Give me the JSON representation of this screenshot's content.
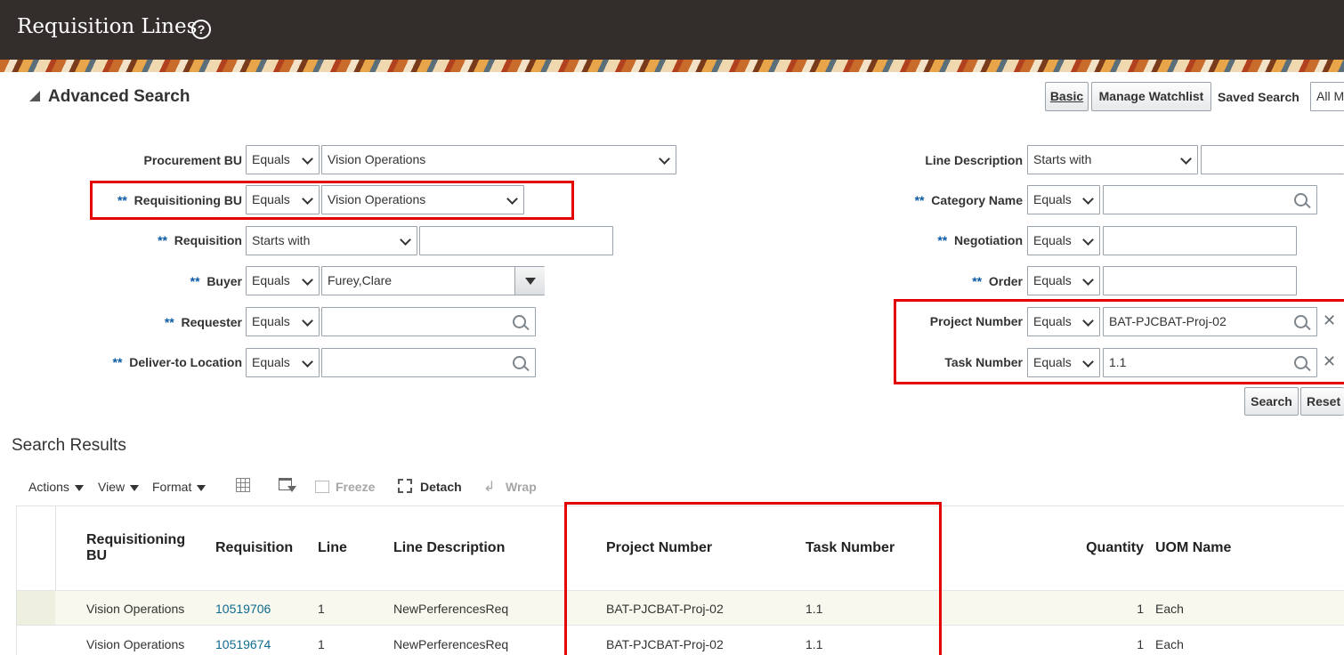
{
  "header": {
    "title": "Requisition Lines",
    "help_icon": "?"
  },
  "search": {
    "heading": "Advanced Search",
    "basic_label": "Basic",
    "watchlist_label": "Manage Watchlist",
    "saved_search_label": "Saved Search",
    "saved_search_value": "All M",
    "required_marker": "**",
    "left_fields": [
      {
        "label": "Procurement BU",
        "operator": "Equals",
        "value": "Vision Operations"
      },
      {
        "label": "Requisitioning BU",
        "operator": "Equals",
        "value": "Vision Operations"
      },
      {
        "label": "Requisition",
        "operator": "Starts with",
        "value": ""
      },
      {
        "label": "Buyer",
        "operator": "Equals",
        "value": "Furey,Clare"
      },
      {
        "label": "Requester",
        "operator": "Equals",
        "value": ""
      },
      {
        "label": "Deliver-to Location",
        "operator": "Equals",
        "value": ""
      }
    ],
    "right_fields": [
      {
        "label": "Line Description",
        "operator": "Starts with",
        "value": ""
      },
      {
        "label": "Category Name",
        "operator": "Equals",
        "value": ""
      },
      {
        "label": "Negotiation",
        "operator": "Equals",
        "value": ""
      },
      {
        "label": "Order",
        "operator": "Equals",
        "value": ""
      },
      {
        "label": "Project Number",
        "operator": "Equals",
        "value": "BAT-PJCBAT-Proj-02"
      },
      {
        "label": "Task Number",
        "operator": "Equals",
        "value": "1.1"
      }
    ],
    "search_label": "Search",
    "reset_label": "Reset"
  },
  "results": {
    "heading": "Search Results",
    "toolbar": {
      "actions": "Actions",
      "view": "View",
      "format": "Format",
      "freeze": "Freeze",
      "detach": "Detach",
      "wrap": "Wrap"
    },
    "columns": [
      "Requisitioning BU",
      "Requisition",
      "Line",
      "Line Description",
      "Project Number",
      "Task Number",
      "Quantity",
      "UOM Name"
    ],
    "rows": [
      {
        "bu": "Vision Operations",
        "requisition": "10519706",
        "line": "1",
        "description": "NewPerferencesReq",
        "project": "BAT-PJCBAT-Proj-02",
        "task": "1.1",
        "quantity": "1",
        "uom": "Each"
      },
      {
        "bu": "Vision Operations",
        "requisition": "10519674",
        "line": "1",
        "description": "NewPerferencesReq",
        "project": "BAT-PJCBAT-Proj-02",
        "task": "1.1",
        "quantity": "1",
        "uom": "Each"
      }
    ]
  },
  "colors": {
    "header_bg": "#332e2b",
    "highlight_border": "#e30000",
    "link": "#0f6a8f",
    "required_marker": "#0b5aa6",
    "selected_row": "#f8f8ee"
  }
}
